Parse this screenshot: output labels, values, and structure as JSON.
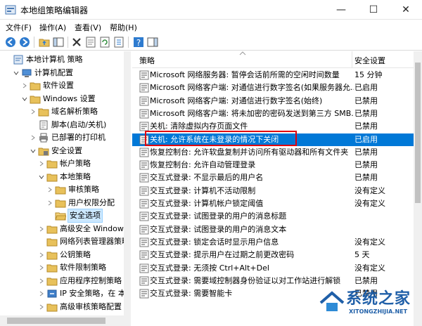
{
  "window": {
    "title": "本地组策略编辑器",
    "min_glyph": "—",
    "max_glyph": "☐",
    "close_glyph": "✕"
  },
  "menu": [
    "文件(F)",
    "操作(A)",
    "查看(V)",
    "帮助(H)"
  ],
  "toolbar_icons": [
    "back-arrow-icon",
    "forward-arrow-icon",
    "up-folder-icon",
    "show-hide-tree-icon",
    "delete-icon",
    "properties-icon",
    "refresh-icon",
    "export-list-icon",
    "help-icon",
    "action-pane-icon"
  ],
  "tree": [
    {
      "label": "本地计算机 策略",
      "icon": "computer-policy-icon",
      "expander": "none"
    },
    {
      "label": "计算机配置",
      "icon": "computer-config-icon",
      "expander": "expanded"
    },
    {
      "label": "软件设置",
      "icon": "folder-icon",
      "expander": "collapsed"
    },
    {
      "label": "Windows 设置",
      "icon": "folder-icon",
      "expander": "expanded"
    },
    {
      "label": "域名解析策略",
      "icon": "folder-icon",
      "expander": "collapsed"
    },
    {
      "label": "脚本(启动/关机)",
      "icon": "script-icon",
      "expander": "none"
    },
    {
      "label": "已部署的打印机",
      "icon": "printer-icon",
      "expander": "collapsed"
    },
    {
      "label": "安全设置",
      "icon": "security-icon",
      "expander": "expanded"
    },
    {
      "label": "帐户策略",
      "icon": "folder-icon",
      "expander": "collapsed"
    },
    {
      "label": "本地策略",
      "icon": "folder-icon",
      "expander": "expanded"
    },
    {
      "label": "审核策略",
      "icon": "folder-icon",
      "expander": "collapsed"
    },
    {
      "label": "用户权限分配",
      "icon": "folder-icon",
      "expander": "collapsed"
    },
    {
      "label": "安全选项",
      "icon": "folder-open-icon",
      "expander": "none",
      "selected": true
    },
    {
      "label": "高级安全 Windows",
      "icon": "folder-icon",
      "expander": "collapsed"
    },
    {
      "label": "网络列表管理器策略",
      "icon": "folder-icon",
      "expander": "none"
    },
    {
      "label": "公钥策略",
      "icon": "folder-icon",
      "expander": "collapsed"
    },
    {
      "label": "软件限制策略",
      "icon": "folder-icon",
      "expander": "collapsed"
    },
    {
      "label": "应用程序控制策略",
      "icon": "folder-icon",
      "expander": "collapsed"
    },
    {
      "label": "IP 安全策略，在 本",
      "icon": "ip-security-icon",
      "expander": "collapsed"
    },
    {
      "label": "高级审核策略配置",
      "icon": "folder-icon",
      "expander": "collapsed"
    }
  ],
  "list": {
    "col_policy": "策略",
    "col_setting": "安全设置",
    "rows": [
      {
        "name": "Microsoft 网络服务器: 暂停会话前所需的空闲时间数量",
        "value": "15 分钟"
      },
      {
        "name": "Microsoft 网络客户端: 对通信进行数字签名(如果服务器允...",
        "value": "已启用"
      },
      {
        "name": "Microsoft 网络客户端: 对通信进行数字签名(始终)",
        "value": "已禁用"
      },
      {
        "name": "Microsoft 网络客户端: 将未加密的密码发送到第三方 SMB...",
        "value": "已禁用"
      },
      {
        "name": "关机: 清除虚拟内存页面文件",
        "value": "已禁用"
      },
      {
        "name": "关机: 允许系统在未登录的情况下关闭",
        "value": "已启用",
        "highlight": true
      },
      {
        "name": "恢复控制台: 允许软盘复制并访问所有驱动器和所有文件夹",
        "value": "已禁用"
      },
      {
        "name": "恢复控制台: 允许自动管理登录",
        "value": "已禁用"
      },
      {
        "name": "交互式登录: 不显示最后的用户名",
        "value": "已禁用"
      },
      {
        "name": "交互式登录: 计算机不活动限制",
        "value": "没有定义"
      },
      {
        "name": "交互式登录: 计算机帐户锁定阈值",
        "value": "没有定义"
      },
      {
        "name": "交互式登录: 试图登录的用户的消息标题",
        "value": ""
      },
      {
        "name": "交互式登录: 试图登录的用户的消息文本",
        "value": ""
      },
      {
        "name": "交互式登录: 锁定会话时显示用户信息",
        "value": "没有定义"
      },
      {
        "name": "交互式登录: 提示用户在过期之前更改密码",
        "value": "5 天"
      },
      {
        "name": "交互式登录: 无须按 Ctrl+Alt+Del",
        "value": "没有定义"
      },
      {
        "name": "交互式登录: 需要域控制器身份验证以对工作站进行解锁",
        "value": "已禁用"
      },
      {
        "name": "交互式登录: 需要智能卡",
        "value": "已禁用"
      }
    ]
  },
  "watermark": {
    "text": "系统之家",
    "url": "XITONGZHIJIA.NET"
  },
  "colors": {
    "selection": "#0078d7",
    "callout_border": "#e0000f",
    "folder": "#e8c15b",
    "watermark": "#1f5fa8"
  }
}
